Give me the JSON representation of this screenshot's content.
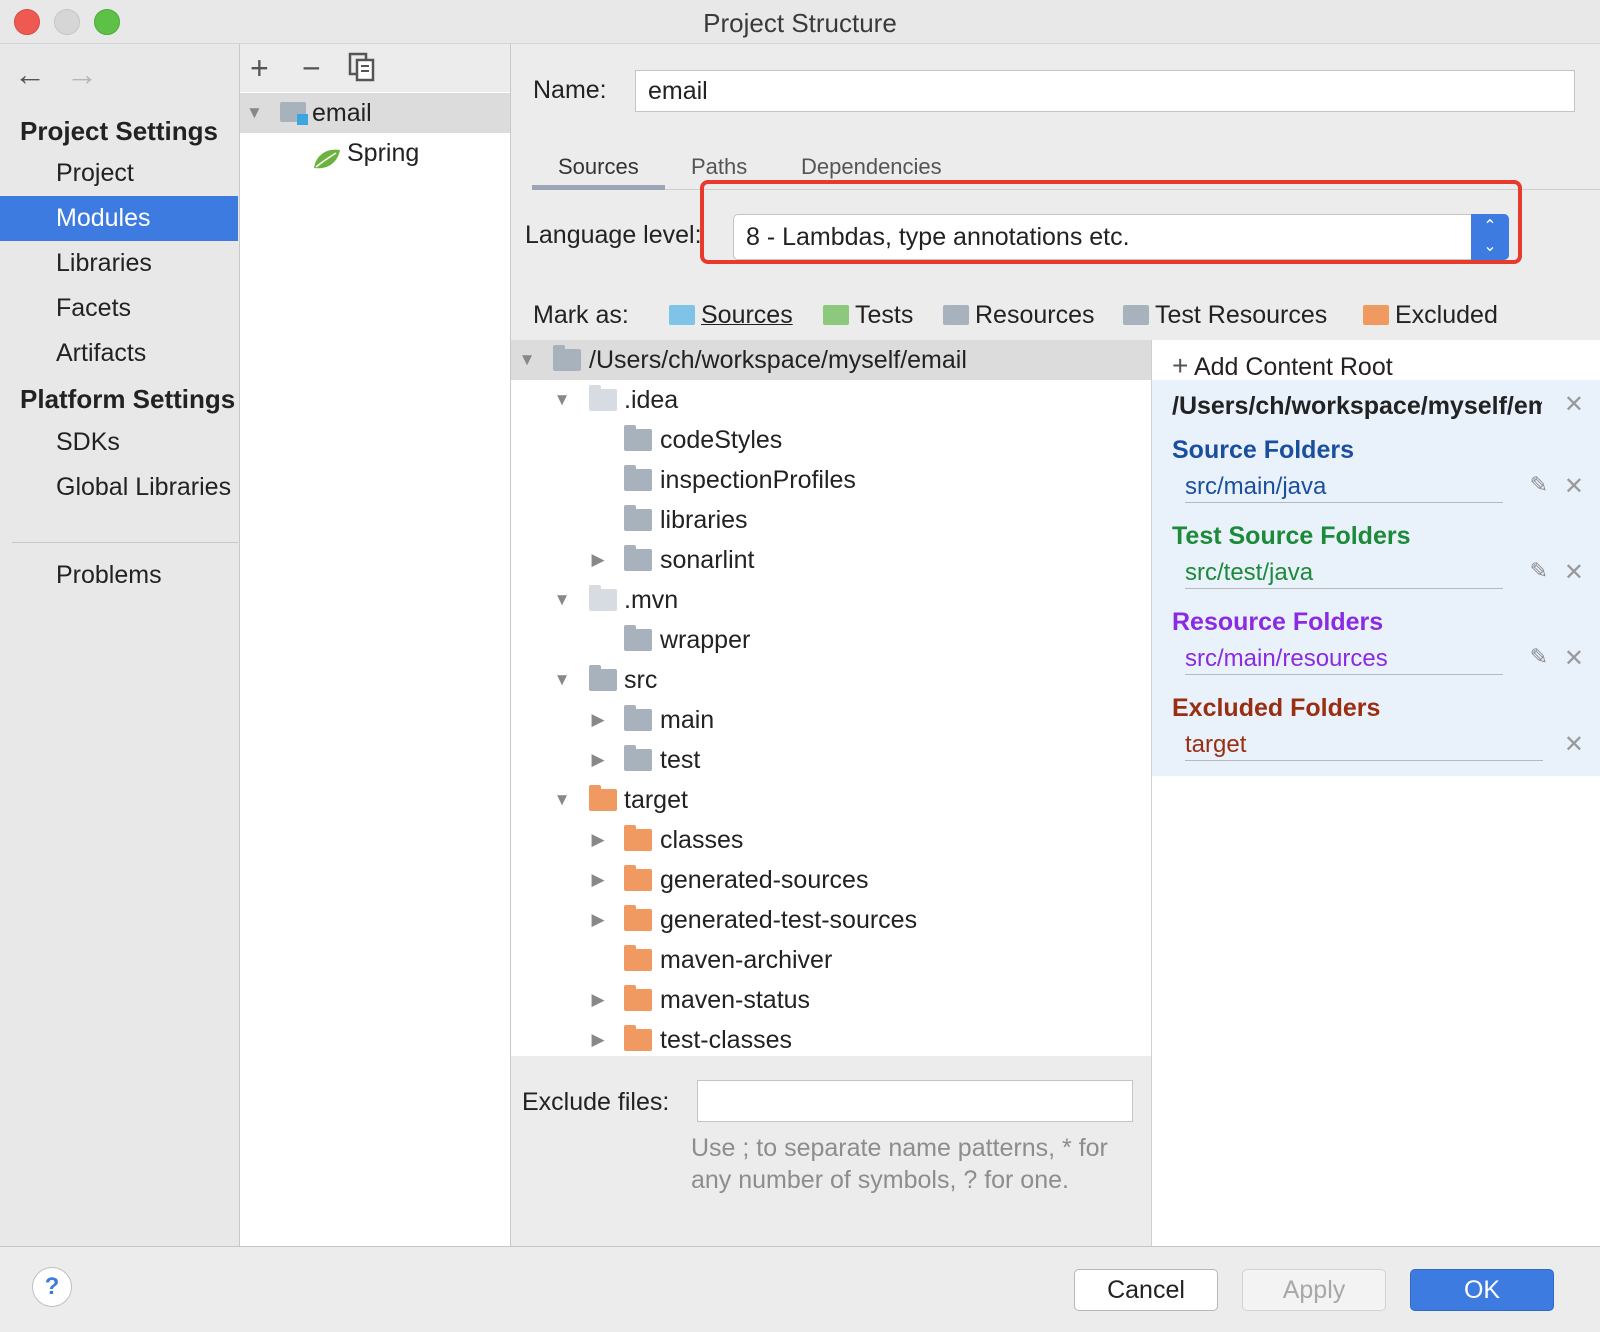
{
  "window": {
    "title": "Project Structure"
  },
  "nav": {
    "back_icon": "arrow-left-icon",
    "forward_icon": "arrow-right-icon",
    "project_settings_header": "Project Settings",
    "project_settings_items": [
      "Project",
      "Modules",
      "Libraries",
      "Facets",
      "Artifacts"
    ],
    "selected": "Modules",
    "platform_settings_header": "Platform Settings",
    "platform_settings_items": [
      "SDKs",
      "Global Libraries"
    ],
    "problems": "Problems"
  },
  "modules_panel": {
    "toolbar": [
      "plus-icon",
      "minus-icon",
      "copy-icon"
    ],
    "module_name": "email",
    "facet_name": "Spring"
  },
  "detail": {
    "name_label": "Name:",
    "name_value": "email",
    "tabs": [
      "Sources",
      "Paths",
      "Dependencies"
    ],
    "active_tab": "Sources",
    "language_level_label": "Language level:",
    "language_level_value": "8 - Lambdas, type annotations etc.",
    "mark_as_label": "Mark as:",
    "mark_as": [
      {
        "label": "Sources",
        "color": "#7fc3e8"
      },
      {
        "label": "Tests",
        "color": "#8dc97c"
      },
      {
        "label": "Resources",
        "color": "#a8b2bd"
      },
      {
        "label": "Test Resources",
        "color": "#a8b2bd"
      },
      {
        "label": "Excluded",
        "color": "#f09a62"
      }
    ]
  },
  "tree": {
    "root": "/Users/ch/workspace/myself/email",
    "items": [
      {
        "label": ".idea",
        "depth": 1,
        "expanded": true,
        "color": "light"
      },
      {
        "label": "codeStyles",
        "depth": 2,
        "expanded": null,
        "color": "gray"
      },
      {
        "label": "inspectionProfiles",
        "depth": 2,
        "expanded": null,
        "color": "gray"
      },
      {
        "label": "libraries",
        "depth": 2,
        "expanded": null,
        "color": "gray"
      },
      {
        "label": "sonarlint",
        "depth": 2,
        "expanded": false,
        "color": "gray"
      },
      {
        "label": ".mvn",
        "depth": 1,
        "expanded": true,
        "color": "light"
      },
      {
        "label": "wrapper",
        "depth": 2,
        "expanded": null,
        "color": "gray"
      },
      {
        "label": "src",
        "depth": 1,
        "expanded": true,
        "color": "gray"
      },
      {
        "label": "main",
        "depth": 2,
        "expanded": false,
        "color": "gray"
      },
      {
        "label": "test",
        "depth": 2,
        "expanded": false,
        "color": "gray"
      },
      {
        "label": "target",
        "depth": 1,
        "expanded": true,
        "color": "orange"
      },
      {
        "label": "classes",
        "depth": 2,
        "expanded": false,
        "color": "orange"
      },
      {
        "label": "generated-sources",
        "depth": 2,
        "expanded": false,
        "color": "orange"
      },
      {
        "label": "generated-test-sources",
        "depth": 2,
        "expanded": false,
        "color": "orange"
      },
      {
        "label": "maven-archiver",
        "depth": 2,
        "expanded": null,
        "color": "orange"
      },
      {
        "label": "maven-status",
        "depth": 2,
        "expanded": false,
        "color": "orange"
      },
      {
        "label": "test-classes",
        "depth": 2,
        "expanded": false,
        "color": "orange"
      }
    ]
  },
  "exclude": {
    "label": "Exclude files:",
    "value": "",
    "hint": "Use ; to separate name patterns, * for any number of symbols, ? for one."
  },
  "content_roots": {
    "add_label": "Add Content Root",
    "path": "/Users/ch/workspace/myself/email",
    "groups": [
      {
        "title": "Source Folders",
        "color": "#1a4f9e",
        "item": "src/main/java",
        "editable": true
      },
      {
        "title": "Test Source Folders",
        "color": "#1c8a38",
        "item": "src/test/java",
        "editable": true
      },
      {
        "title": "Resource Folders",
        "color": "#8a2be2",
        "item": "src/main/resources",
        "editable": true
      },
      {
        "title": "Excluded Folders",
        "color": "#9a2e12",
        "item": "target",
        "editable": false
      }
    ]
  },
  "footer": {
    "help": "?",
    "cancel": "Cancel",
    "apply": "Apply",
    "ok": "OK"
  }
}
